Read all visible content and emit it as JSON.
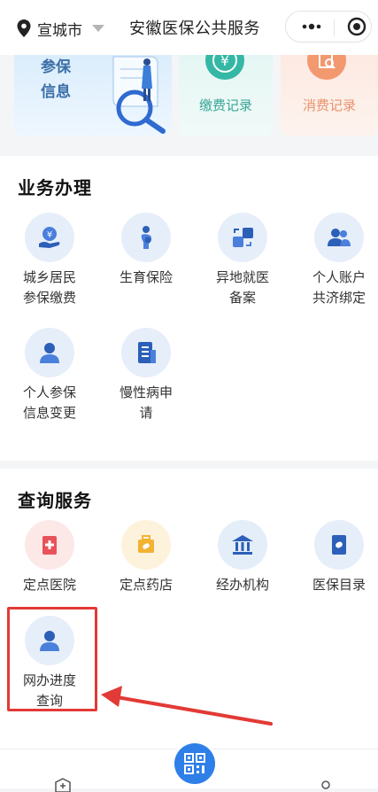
{
  "header": {
    "city": "宣城市",
    "title": "安徽医保公共服务",
    "icons": {
      "location": "location-pin-icon",
      "caret": "caret-down-icon",
      "more": "more-dots-icon",
      "close": "target-close-icon"
    }
  },
  "top_cards": {
    "insurance_info": "参保\n信息",
    "payment_record": "缴费记录",
    "consumption_record": "消费记录"
  },
  "business": {
    "title": "业务办理",
    "items": [
      {
        "label": "城乡居民\n参保缴费",
        "icon": "yuan-hand-icon"
      },
      {
        "label": "生育保险",
        "icon": "maternity-icon"
      },
      {
        "label": "异地就医\n备案",
        "icon": "transfer-icon"
      },
      {
        "label": "个人账户\n共济绑定",
        "icon": "users-icon"
      },
      {
        "label": "个人参保\n信息变更",
        "icon": "user-icon"
      },
      {
        "label": "慢性病申\n请",
        "icon": "building-document-icon"
      }
    ]
  },
  "query": {
    "title": "查询服务",
    "items": [
      {
        "label": "定点医院",
        "icon": "hospital-icon"
      },
      {
        "label": "定点药店",
        "icon": "pharmacy-icon"
      },
      {
        "label": "经办机构",
        "icon": "institution-icon"
      },
      {
        "label": "医保目录",
        "icon": "catalog-icon"
      },
      {
        "label": "网办进度\n查询",
        "icon": "user-icon"
      }
    ]
  },
  "colors": {
    "accent": "#2f7fe8",
    "icon_blue": "#4a7fdc",
    "highlight": "#e23a36"
  }
}
